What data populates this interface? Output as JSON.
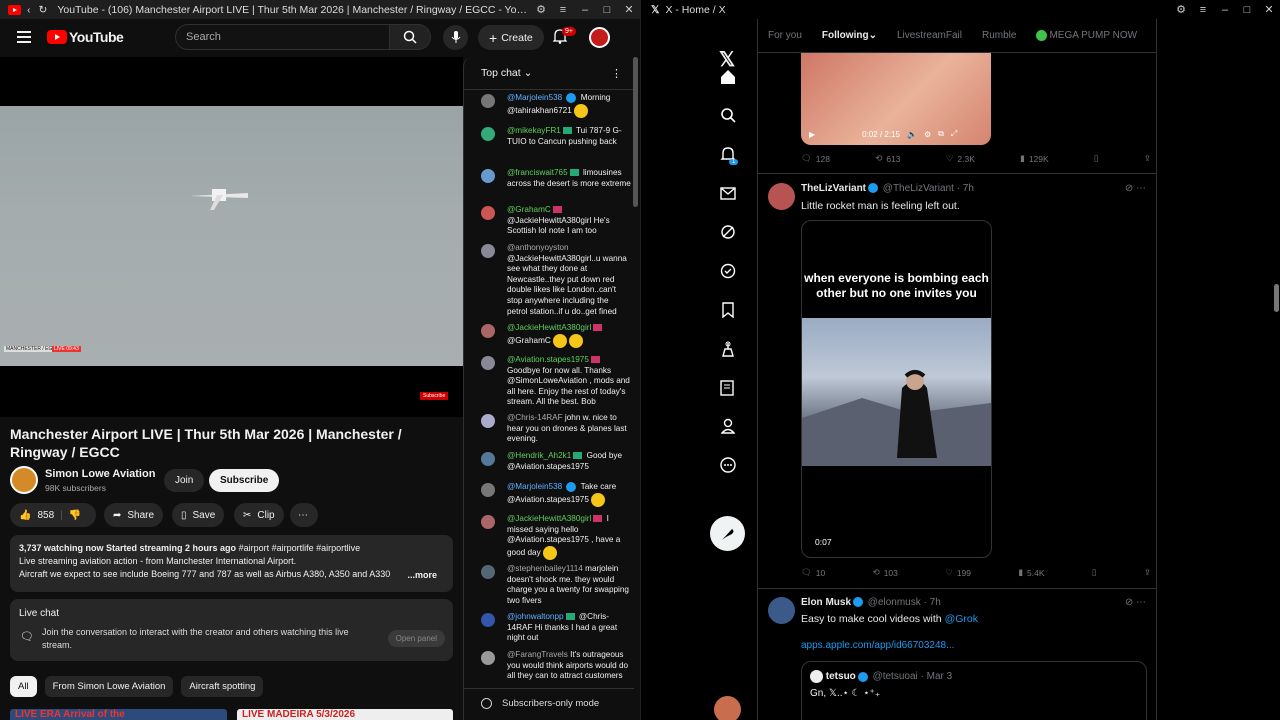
{
  "yt": {
    "window_title": "YouTube - (106) Manchester Airport LIVE | Thur 5th Mar 2026 | Manchester / Ringway / EGCC - YouTube",
    "logo": "YouTube",
    "search_placeholder": "Search",
    "create_label": "Create",
    "notif_count": "9+",
    "video_watermark": "MANCHESTER / EGCC",
    "video_live": "LIVE 09:43",
    "video_subscribe": "Subscribe",
    "title": "Manchester Airport LIVE | Thur 5th Mar 2026 | Manchester / Ringway / EGCC",
    "channel": "Simon Lowe Aviation",
    "subscribers": "98K subscribers",
    "join": "Join",
    "subscribe": "Subscribe",
    "likes": "858",
    "share": "Share",
    "save": "Save",
    "clip": "Clip",
    "desc_stats": "3,737 watching now  Started streaming 2 hours ago",
    "desc_tags": "#airport #airportlife #airportlive",
    "desc_line1": "Live streaming aviation action - from Manchester International Airport.",
    "desc_line2": "Aircraft we expect to see include Boeing 777 and 787 as well as Airbus A380, A350 and A330",
    "desc_more": "...more",
    "livechat_title": "Live chat",
    "livechat_text": "Join the conversation to interact with the creator and others watching this live stream.",
    "open_panel": "Open panel",
    "chips": [
      "All",
      "From Simon Lowe Aviation",
      "Aircraft spotting"
    ],
    "thumb1": "LIVE ERA   Arrival of the",
    "thumb2": "LIVE MADEIRA   5/3/2026",
    "chat_header": "Top chat",
    "chat_footer": "Subscribers-only mode",
    "messages": [
      {
        "author": "@Marjolein538",
        "text": "Morning @tahirakhan6721"
      },
      {
        "author": "@mikekayFR1",
        "text": "Tui 787-9 G-TUIO to Cancun pushing back"
      },
      {
        "author": "@franciswait765",
        "text": "limousines across the desert is more extreme"
      },
      {
        "author": "@GrahamC",
        "text": "@JackieHewittA380girl He's Scottish lol note I am too"
      },
      {
        "author": "@anthonyoyston",
        "text": "@JackieHewittA380girl..u wanna see what they done at Newcastle..they put down red double likes like London..can't stop anywhere including the petrol station..if u do..get fined"
      },
      {
        "author": "@JackieHewittA380girl",
        "text": "@GrahamC"
      },
      {
        "author": "@Aviation.stapes1975",
        "text": "Goodbye for now all. Thanks @SimonLoweAviation , mods and all here. Enjoy the rest of today's stream. All the best. Bob"
      },
      {
        "author": "@Chris-14RAF",
        "text": "john w. nice to hear you on drones & planes last evening."
      },
      {
        "author": "@Hendrik_Ah2k1",
        "text": "Good bye @Aviation.stapes1975"
      },
      {
        "author": "@Marjolein538",
        "text": "Take care @Aviation.stapes1975"
      },
      {
        "author": "@JackieHewittA380girl",
        "text": "I missed saying hello @Aviation.stapes1975 , have a good day"
      },
      {
        "author": "@stephenbailey1114",
        "text": "marjolein doesn't shock me. they would charge you a twenty for swapping two fivers"
      },
      {
        "author": "@johnwaltonpp",
        "text": "@Chris-14RAF Hi thanks I had a great night out"
      },
      {
        "author": "@FarangTravels",
        "text": "It's outrageous you would think airports would do all they can to attract customers"
      }
    ]
  },
  "x": {
    "window_title": "X - Home / X",
    "tabs": [
      "For you",
      "Following",
      "LivestreamFail",
      "Rumble",
      "MEGA PUMP NOW"
    ],
    "notif_count": "1",
    "post1": {
      "time": "0:02 / 2:15",
      "replies": "128",
      "reposts": "613",
      "likes": "2.3K",
      "views": "129K"
    },
    "post2": {
      "name": "TheLizVariant",
      "handle": "@TheLizVariant · 7h",
      "text": "Little rocket man is feeling left out.",
      "caption": "when everyone is bombing each other but no one invites you",
      "duration": "0:07",
      "replies": "10",
      "reposts": "103",
      "likes": "199",
      "views": "5.4K"
    },
    "post3": {
      "name": "Elon Musk",
      "handle": "@elonmusk · 7h",
      "text": "Easy to make cool videos with",
      "mention": "@Grok",
      "link": "apps.apple.com/app/id66703248...",
      "quote_name": "tetsuo",
      "quote_handle": "@tetsuoai · Mar 3",
      "quote_text": "Gn, 𝕏..⋆ ☾ ⋆⁺₊"
    }
  }
}
